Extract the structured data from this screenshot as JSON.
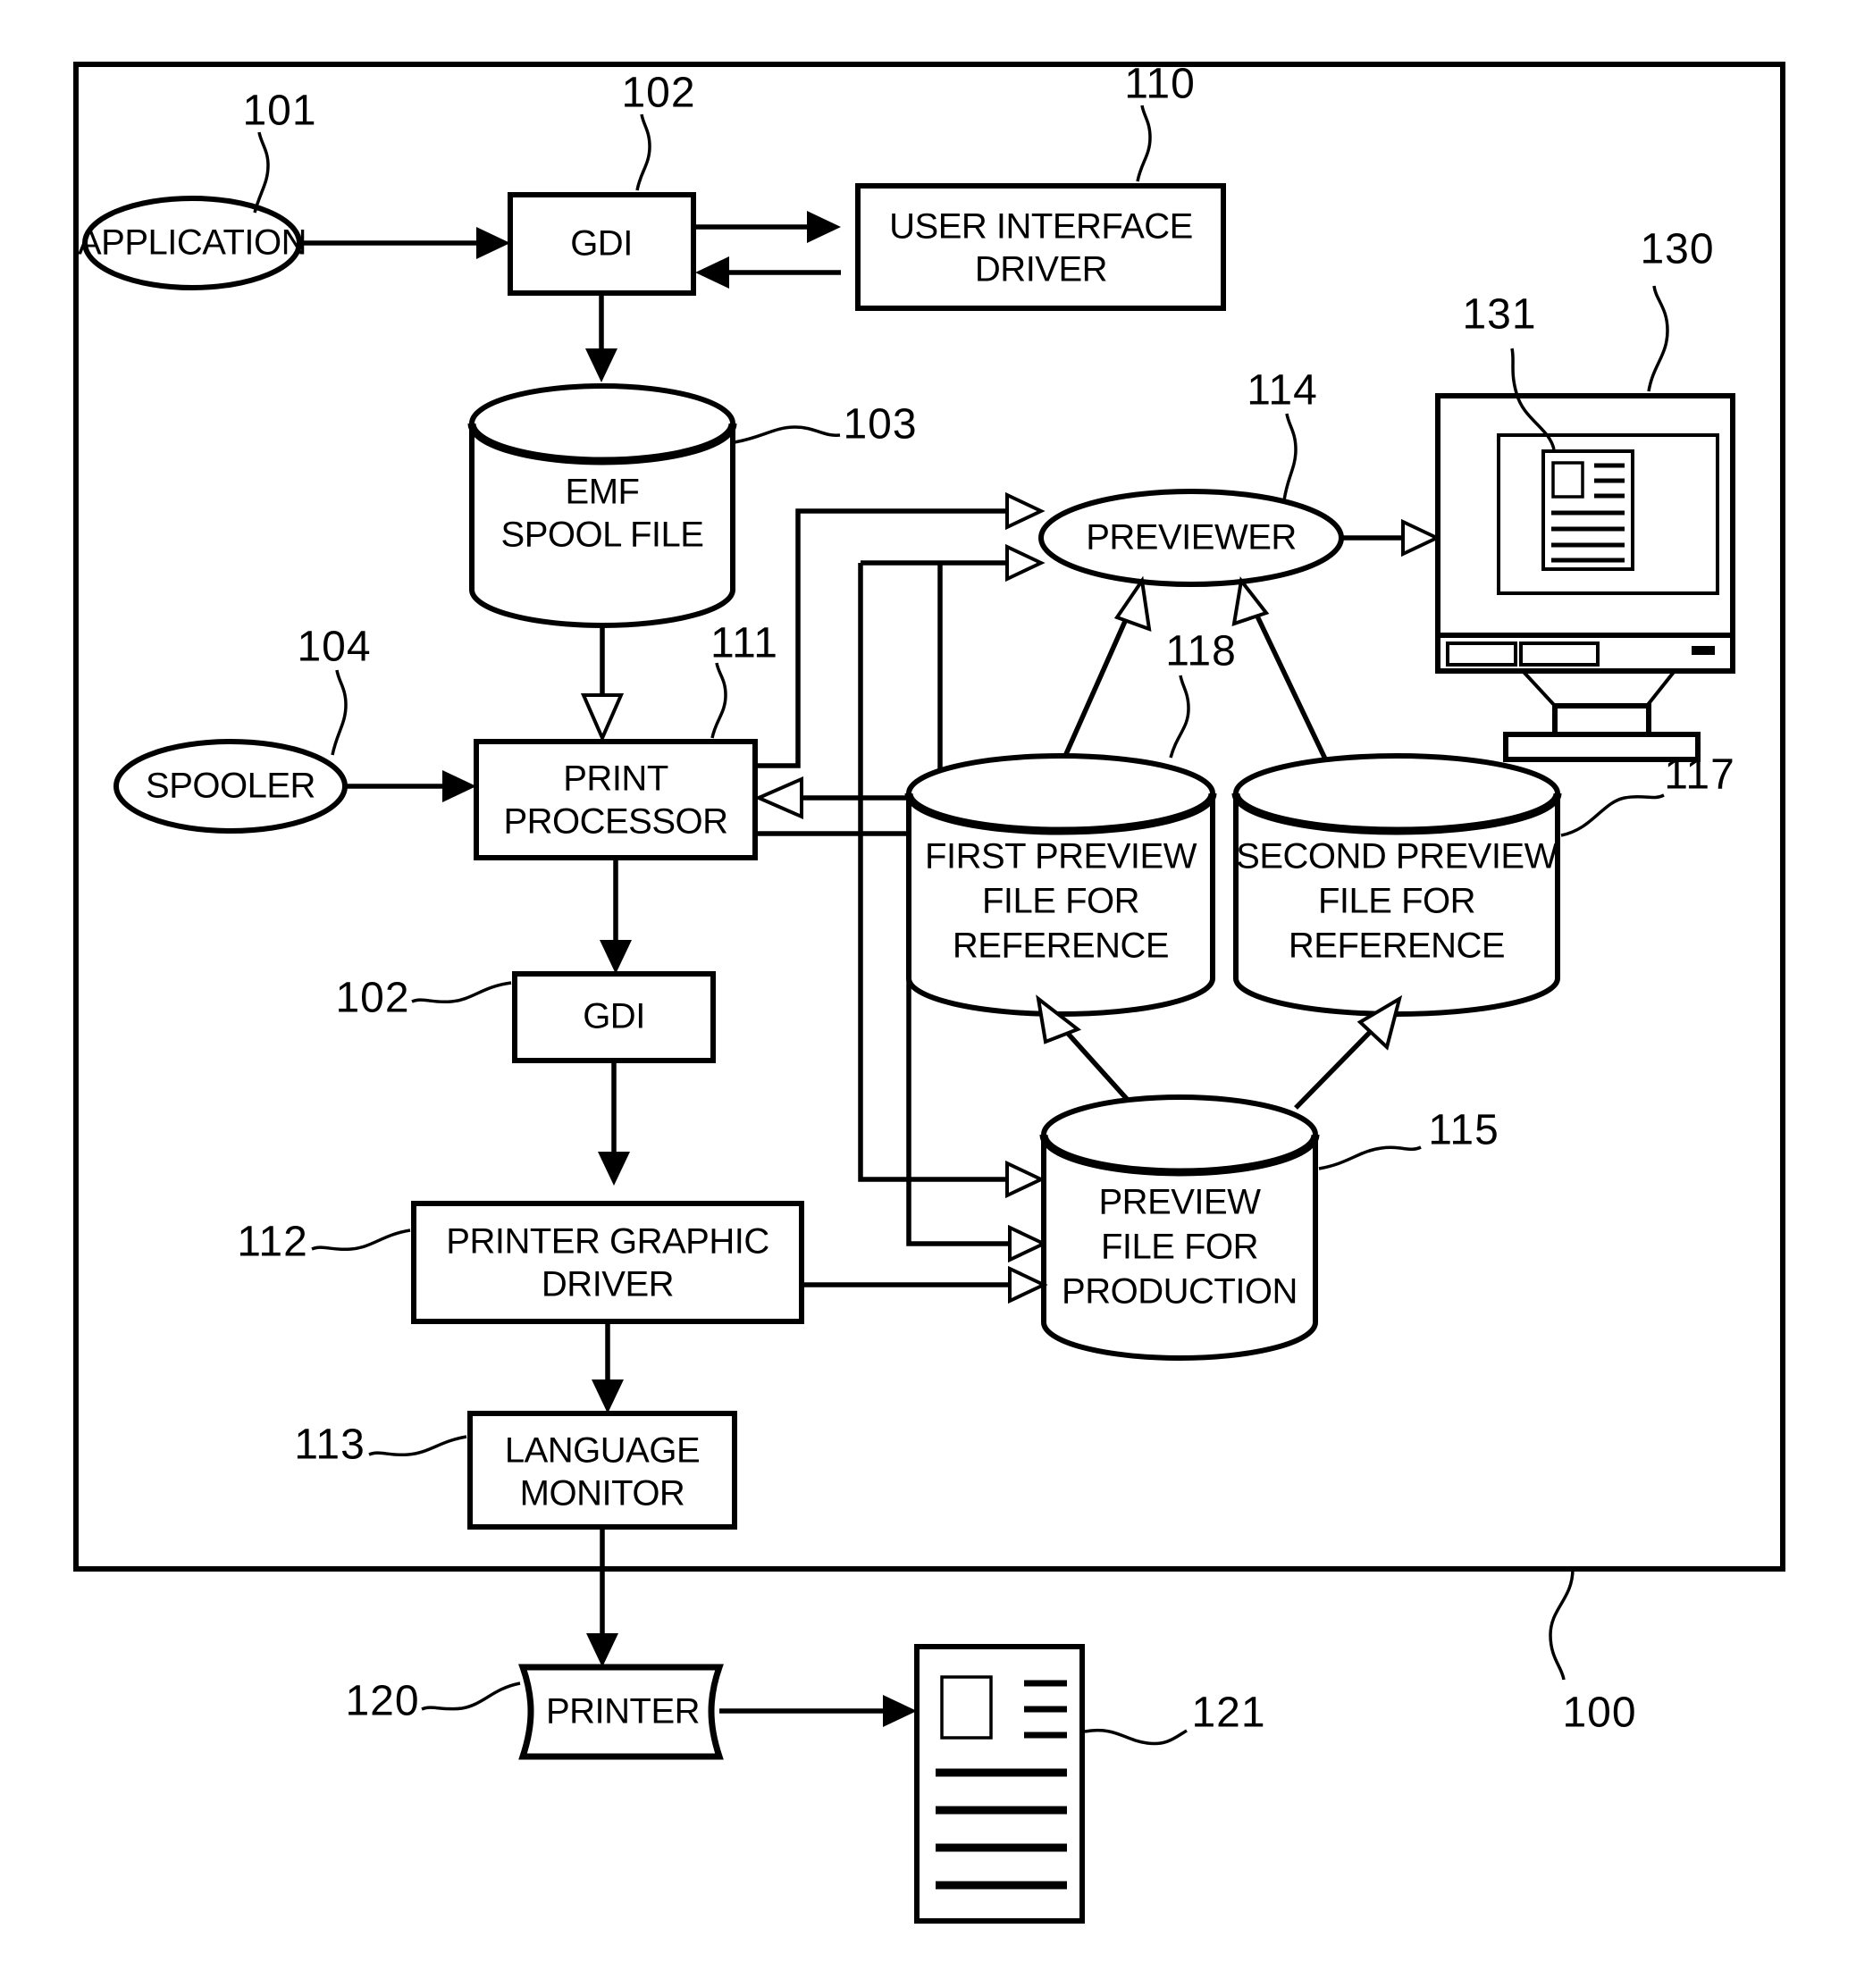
{
  "figure": {
    "title": "Printing system block diagram",
    "system_ref": "100"
  },
  "nodes": {
    "application": {
      "label": "APPLICATION",
      "ref": "101",
      "shape": "ellipse"
    },
    "gdi_top": {
      "label": "GDI",
      "ref": "102",
      "shape": "rect"
    },
    "ui_driver": {
      "label_line1": "USER INTERFACE",
      "label_line2": "DRIVER",
      "ref": "110",
      "shape": "rect"
    },
    "emf_spool": {
      "label_line1": "EMF",
      "label_line2": "SPOOL FILE",
      "ref": "103",
      "shape": "cylinder"
    },
    "previewer": {
      "label": "PREVIEWER",
      "ref": "114",
      "shape": "ellipse"
    },
    "monitor": {
      "ref": "130",
      "shape": "crt-monitor"
    },
    "monitor_page": {
      "ref": "131",
      "shape": "document-thumbnail"
    },
    "spooler": {
      "label": "SPOOLER",
      "ref": "104",
      "shape": "ellipse"
    },
    "print_processor": {
      "label_line1": "PRINT",
      "label_line2": "PROCESSOR",
      "ref": "111",
      "shape": "rect"
    },
    "first_preview": {
      "label_line1": "FIRST PREVIEW",
      "label_line2": "FILE FOR",
      "label_line3": "REFERENCE",
      "ref": "118",
      "shape": "cylinder"
    },
    "second_preview": {
      "label_line1": "SECOND PREVIEW",
      "label_line2": "FILE FOR",
      "label_line3": "REFERENCE",
      "ref": "117",
      "shape": "cylinder"
    },
    "gdi_bottom": {
      "label": "GDI",
      "ref": "102",
      "shape": "rect"
    },
    "preview_production": {
      "label_line1": "PREVIEW",
      "label_line2": "FILE FOR",
      "label_line3": "PRODUCTION",
      "ref": "115",
      "shape": "cylinder"
    },
    "printer_graphic_driver": {
      "label_line1": "PRINTER GRAPHIC",
      "label_line2": "DRIVER",
      "ref": "112",
      "shape": "rect"
    },
    "language_monitor": {
      "label_line1": "LANGUAGE",
      "label_line2": "MONITOR",
      "ref": "113",
      "shape": "rect"
    },
    "printer": {
      "label": "PRINTER",
      "ref": "120",
      "shape": "wave-rect"
    },
    "printed_document": {
      "ref": "121",
      "shape": "document"
    }
  },
  "reference_numerals": [
    "101",
    "102",
    "110",
    "130",
    "131",
    "103",
    "114",
    "104",
    "111",
    "118",
    "117",
    "115",
    "112",
    "113",
    "120",
    "121",
    "100"
  ],
  "colors": {
    "stroke": "#000000",
    "background": "#ffffff"
  }
}
